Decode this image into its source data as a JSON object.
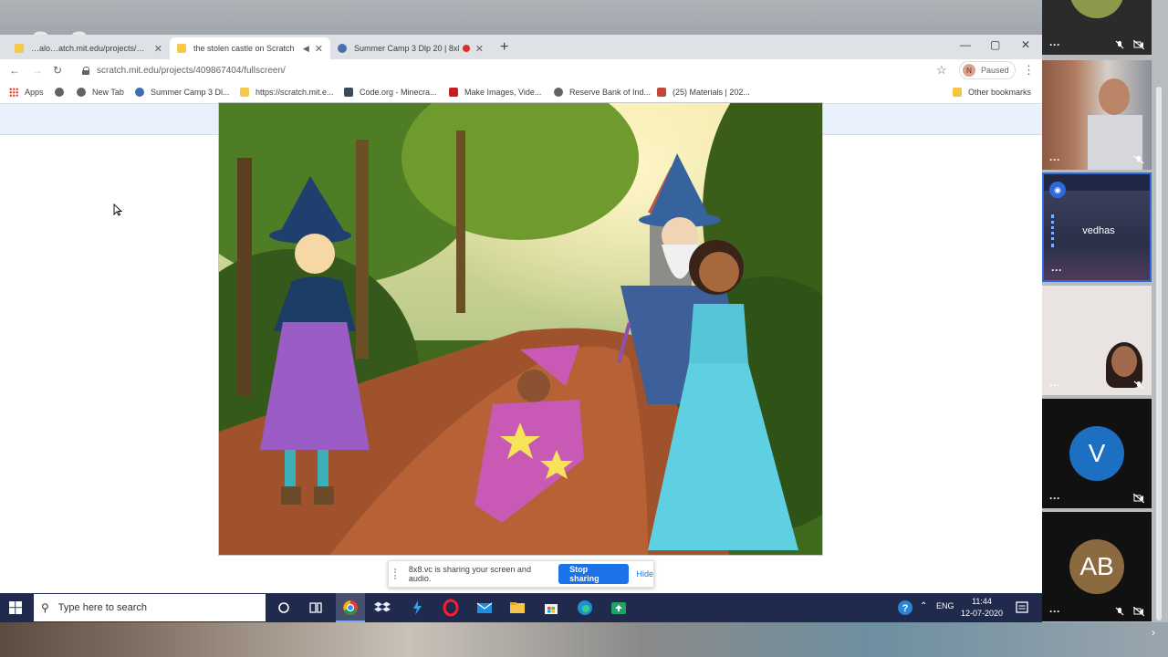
{
  "brand": {
    "watermark": "8x8"
  },
  "browser": {
    "tabs": [
      {
        "title": "…alo…atch.mit.edu/projects/…"
      },
      {
        "title": "the stolen castle on Scratch"
      },
      {
        "title": "Summer Camp 3 Dlp 20 | 8x8"
      }
    ],
    "url": "scratch.mit.edu/projects/409867404/fullscreen/",
    "profile": {
      "initial": "N",
      "status": "Paused"
    },
    "bookmarks": [
      {
        "label": "Apps"
      },
      {
        "label": ""
      },
      {
        "label": "New Tab"
      },
      {
        "label": "Summer Camp 3 Dl..."
      },
      {
        "label": "https://scratch.mit.e..."
      },
      {
        "label": "Code.org - Minecra..."
      },
      {
        "label": "Make Images, Vide..."
      },
      {
        "label": "Reserve Bank of Ind..."
      },
      {
        "label": "(25) Materials | 202..."
      }
    ],
    "other_bookmarks": "Other bookmarks"
  },
  "screen_share": {
    "message": "8x8.vc is sharing your screen and audio.",
    "stop_label": "Stop sharing",
    "hide_label": "Hide"
  },
  "taskbar": {
    "search_placeholder": "Type here to search",
    "lang": "ENG",
    "time": "11:44",
    "date": "12-07-2020"
  },
  "participants": [
    {
      "name": "",
      "type": "video"
    },
    {
      "name": "",
      "type": "video"
    },
    {
      "name": "vedhas",
      "type": "screen"
    },
    {
      "name": "",
      "type": "video"
    },
    {
      "name": "V",
      "type": "avatar",
      "color": "#1d6fc2"
    },
    {
      "name": "AB",
      "type": "avatar",
      "color": "#8a6a3e"
    }
  ],
  "colors": {
    "accent": "#1a73e8",
    "taskbar": "#1f2a4d",
    "scratch_bar": "#e9f1fc"
  }
}
